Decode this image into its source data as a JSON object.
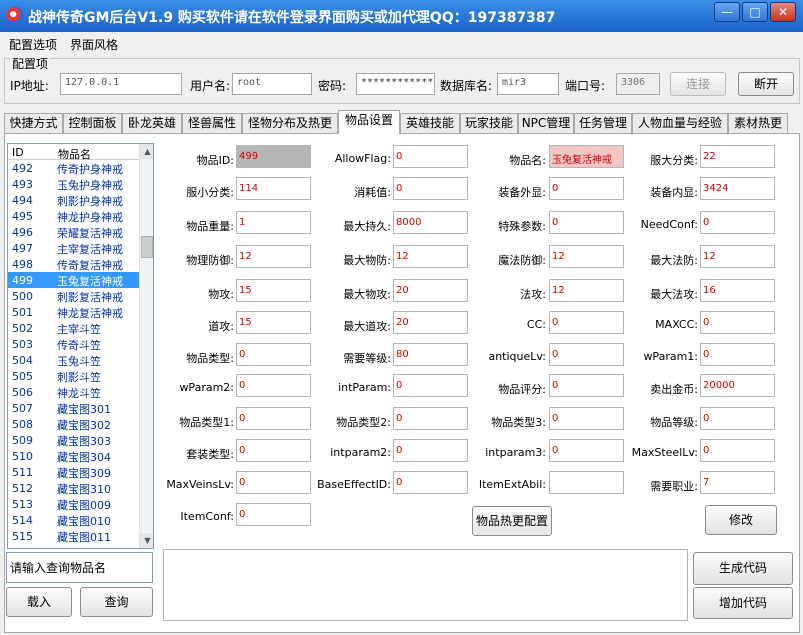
{
  "window": {
    "title": "战神传奇GM后台V1.9   购买软件请在软件登录界面购买或加代理QQ：197387387",
    "min": "—",
    "max": "□",
    "close": "✕"
  },
  "menu": [
    "配置选项",
    "界面风格"
  ],
  "config": {
    "legend": "配置项",
    "ip_label": "IP地址:",
    "ip": "127.0.0.1",
    "user_label": "用户名:",
    "user": "root",
    "pass_label": "密码:",
    "pass": "************",
    "db_label": "数据库名:",
    "db": "mir3",
    "port_label": "端口号:",
    "port": "3306",
    "connect": "连接",
    "disconnect": "断开"
  },
  "tabs": [
    "快捷方式",
    "控制面板",
    "卧龙英雄",
    "怪兽属性",
    "怪物分布及热更",
    "物品设置",
    "英雄技能",
    "玩家技能",
    "NPC管理",
    "任务管理",
    "人物血量与经验",
    "素材热更"
  ],
  "list": {
    "col_id": "ID",
    "col_name": "物品名",
    "selected_id": "499",
    "rows": [
      {
        "id": "492",
        "name": "传奇护身神戒"
      },
      {
        "id": "493",
        "name": "玉兔护身神戒"
      },
      {
        "id": "494",
        "name": "刺影护身神戒"
      },
      {
        "id": "495",
        "name": "神龙护身神戒"
      },
      {
        "id": "496",
        "name": "荣耀复活神戒"
      },
      {
        "id": "497",
        "name": "主宰复活神戒"
      },
      {
        "id": "498",
        "name": "传奇复活神戒"
      },
      {
        "id": "499",
        "name": "玉兔复活神戒"
      },
      {
        "id": "500",
        "name": "刺影复活神戒"
      },
      {
        "id": "501",
        "name": "神龙复活神戒"
      },
      {
        "id": "502",
        "name": "主宰斗笠"
      },
      {
        "id": "503",
        "name": "传奇斗笠"
      },
      {
        "id": "504",
        "name": "玉兔斗笠"
      },
      {
        "id": "505",
        "name": "刺影斗笠"
      },
      {
        "id": "506",
        "name": "神龙斗笠"
      },
      {
        "id": "507",
        "name": "藏宝图301"
      },
      {
        "id": "508",
        "name": "藏宝图302"
      },
      {
        "id": "509",
        "name": "藏宝图303"
      },
      {
        "id": "510",
        "name": "藏宝图304"
      },
      {
        "id": "511",
        "name": "藏宝图309"
      },
      {
        "id": "512",
        "name": "藏宝图310"
      },
      {
        "id": "513",
        "name": "藏宝图009"
      },
      {
        "id": "514",
        "name": "藏宝图010"
      },
      {
        "id": "515",
        "name": "藏宝图011"
      }
    ]
  },
  "search": {
    "value": "请输入查询物品名",
    "load": "载入",
    "query": "查询"
  },
  "fields": [
    {
      "label": "物品ID:",
      "value": "499"
    },
    {
      "label": "AllowFlag:",
      "value": "0"
    },
    {
      "label": "物品名:",
      "value": "玉兔复活神戒"
    },
    {
      "label": "服大分类:",
      "value": "22"
    },
    {
      "label": "服小分类:",
      "value": "114"
    },
    {
      "label": "消耗值:",
      "value": "0"
    },
    {
      "label": "装备外显:",
      "value": "0"
    },
    {
      "label": "装备内显:",
      "value": "3424"
    },
    {
      "label": "物品重量:",
      "value": "1"
    },
    {
      "label": "最大持久:",
      "value": "8000"
    },
    {
      "label": "特殊参数:",
      "value": "0"
    },
    {
      "label": "NeedConf:",
      "value": "0"
    },
    {
      "label": "物理防御:",
      "value": "12"
    },
    {
      "label": "最大物防:",
      "value": "12"
    },
    {
      "label": "魔法防御:",
      "value": "12"
    },
    {
      "label": "最大法防:",
      "value": "12"
    },
    {
      "label": "物攻:",
      "value": "15"
    },
    {
      "label": "最大物攻:",
      "value": "20"
    },
    {
      "label": "法攻:",
      "value": "12"
    },
    {
      "label": "最大法攻:",
      "value": "16"
    },
    {
      "label": "道攻:",
      "value": "15"
    },
    {
      "label": "最大道攻:",
      "value": "20"
    },
    {
      "label": "CC:",
      "value": "0"
    },
    {
      "label": "MAXCC:",
      "value": "0"
    },
    {
      "label": "物品类型:",
      "value": "0"
    },
    {
      "label": "需要等级:",
      "value": "80"
    },
    {
      "label": "antiqueLv:",
      "value": "0"
    },
    {
      "label": "wParam1:",
      "value": "0"
    },
    {
      "label": "wParam2:",
      "value": "0"
    },
    {
      "label": "intParam:",
      "value": "0"
    },
    {
      "label": "物品评分:",
      "value": "0"
    },
    {
      "label": "卖出金币:",
      "value": "20000"
    },
    {
      "label": "物品类型1:",
      "value": "0"
    },
    {
      "label": "物品类型2:",
      "value": "0"
    },
    {
      "label": "物品类型3:",
      "value": "0"
    },
    {
      "label": "物品等级:",
      "value": "0"
    },
    {
      "label": "套装类型:",
      "value": "0"
    },
    {
      "label": "intparam2:",
      "value": "0"
    },
    {
      "label": "intparam3:",
      "value": "0"
    },
    {
      "label": "MaxSteelLv:",
      "value": "0"
    },
    {
      "label": "MaxVeinsLv:",
      "value": "0"
    },
    {
      "label": "BaseEffectID:",
      "value": "0"
    },
    {
      "label": "ItemExtAbil:",
      "value": ""
    },
    {
      "label": "需要职业:",
      "value": "7"
    },
    {
      "label": "ItemConf:",
      "value": "0"
    }
  ],
  "buttons": {
    "hot_config": "物品热更配置",
    "modify": "修改",
    "gen_code": "生成代码",
    "add_code": "增加代码"
  },
  "code": ""
}
